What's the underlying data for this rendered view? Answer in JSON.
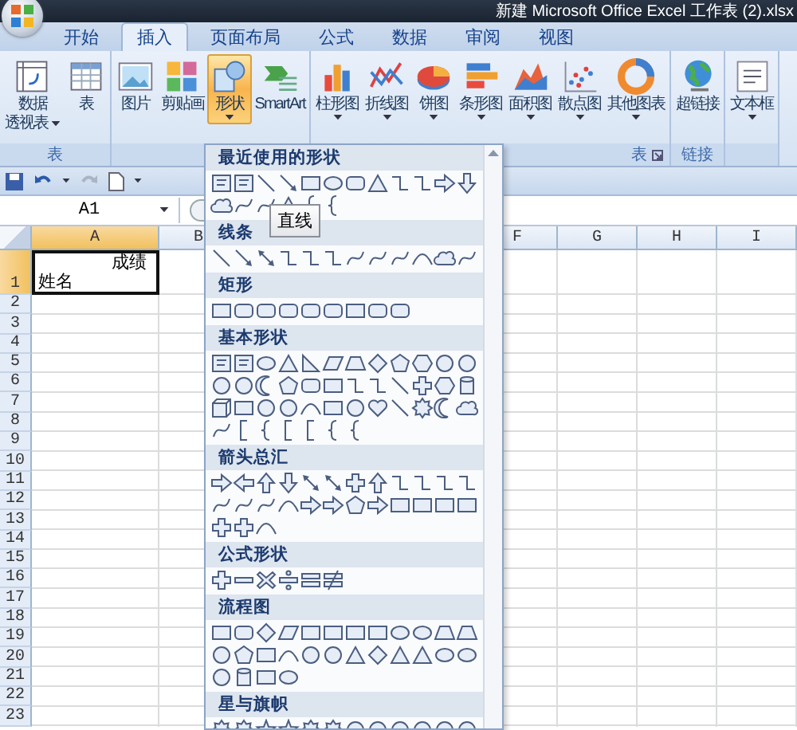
{
  "window": {
    "title": "新建 Microsoft Office Excel 工作表 (2).xlsx"
  },
  "tabs": [
    {
      "label": "开始",
      "selected": false
    },
    {
      "label": "插入",
      "selected": true
    },
    {
      "label": "页面布局",
      "selected": false
    },
    {
      "label": "公式",
      "selected": false
    },
    {
      "label": "数据",
      "selected": false
    },
    {
      "label": "审阅",
      "selected": false
    },
    {
      "label": "视图",
      "selected": false
    }
  ],
  "ribbon": {
    "groups": [
      {
        "label": "表",
        "launcher": false,
        "buttons": [
          {
            "lines": [
              "数据",
              "透视表"
            ],
            "dropdown": true,
            "pressed": false
          },
          {
            "lines": [
              "表"
            ],
            "dropdown": false,
            "pressed": false
          }
        ]
      },
      {
        "launcher": false,
        "buttons": [
          {
            "lines": [
              "图片"
            ],
            "dropdown": false,
            "pressed": false
          },
          {
            "lines": [
              "剪贴画"
            ],
            "dropdown": false,
            "pressed": false
          },
          {
            "lines": [
              "形状"
            ],
            "dropdown": true,
            "pressed": true
          },
          {
            "lines": [
              "SmartArt"
            ],
            "dropdown": false,
            "pressed": false
          }
        ]
      },
      {
        "label": "表",
        "launcher": true,
        "buttons": [
          {
            "lines": [
              "柱形图"
            ],
            "dropdown": true,
            "pressed": false
          },
          {
            "lines": [
              "折线图"
            ],
            "dropdown": true,
            "pressed": false
          },
          {
            "lines": [
              "饼图"
            ],
            "dropdown": true,
            "pressed": false
          },
          {
            "lines": [
              "条形图"
            ],
            "dropdown": true,
            "pressed": false
          },
          {
            "lines": [
              "面积图"
            ],
            "dropdown": true,
            "pressed": false
          },
          {
            "lines": [
              "散点图"
            ],
            "dropdown": true,
            "pressed": false
          },
          {
            "lines": [
              "其他图表"
            ],
            "dropdown": true,
            "pressed": false
          }
        ]
      },
      {
        "label": "链接",
        "launcher": false,
        "buttons": [
          {
            "lines": [
              "超链接"
            ],
            "dropdown": false,
            "pressed": false
          }
        ]
      },
      {
        "launcher": false,
        "buttons": [
          {
            "lines": [
              "文本框"
            ],
            "dropdown": true,
            "pressed": false
          }
        ]
      }
    ]
  },
  "formula_bar": {
    "name_box": "A1"
  },
  "sheet": {
    "columns_left": [
      {
        "label": "A",
        "selected": true
      },
      {
        "label": "B",
        "selected": false
      }
    ],
    "columns_right": [
      {
        "label": "F",
        "selected": false
      },
      {
        "label": "G",
        "selected": false
      },
      {
        "label": "H",
        "selected": false
      },
      {
        "label": "I",
        "selected": false
      }
    ],
    "active_cell": {
      "top_text": "成绩",
      "bottom_text": "姓名",
      "selected": true
    },
    "rows": [
      {
        "header": "1",
        "selected": true
      },
      {
        "header": "2",
        "selected": false
      },
      {
        "header": "3",
        "selected": false
      },
      {
        "header": "4",
        "selected": false
      },
      {
        "header": "5",
        "selected": false
      },
      {
        "header": "6",
        "selected": false
      },
      {
        "header": "7",
        "selected": false
      },
      {
        "header": "8",
        "selected": false
      },
      {
        "header": "9",
        "selected": false
      },
      {
        "header": "10",
        "selected": false
      },
      {
        "header": "11",
        "selected": false
      },
      {
        "header": "12",
        "selected": false
      },
      {
        "header": "13",
        "selected": false
      },
      {
        "header": "14",
        "selected": false
      },
      {
        "header": "15",
        "selected": false
      },
      {
        "header": "16",
        "selected": false
      },
      {
        "header": "17",
        "selected": false
      },
      {
        "header": "18",
        "selected": false
      },
      {
        "header": "19",
        "selected": false
      },
      {
        "header": "20",
        "selected": false
      },
      {
        "header": "21",
        "selected": false
      },
      {
        "header": "22",
        "selected": false
      },
      {
        "header": "23",
        "selected": false
      }
    ]
  },
  "shapes_dropdown": {
    "tooltip": "直线",
    "sections": [
      {
        "title": "最近使用的形状",
        "kind": "recent"
      },
      {
        "title": "线条",
        "kind": "lines"
      },
      {
        "title": "矩形",
        "kind": "rectangles"
      },
      {
        "title": "基本形状",
        "kind": "basic"
      },
      {
        "title": "箭头总汇",
        "kind": "arrows"
      },
      {
        "title": "公式形状",
        "kind": "equation"
      },
      {
        "title": "流程图",
        "kind": "flowchart"
      },
      {
        "title": "星与旗帜",
        "kind": "stars"
      }
    ]
  }
}
